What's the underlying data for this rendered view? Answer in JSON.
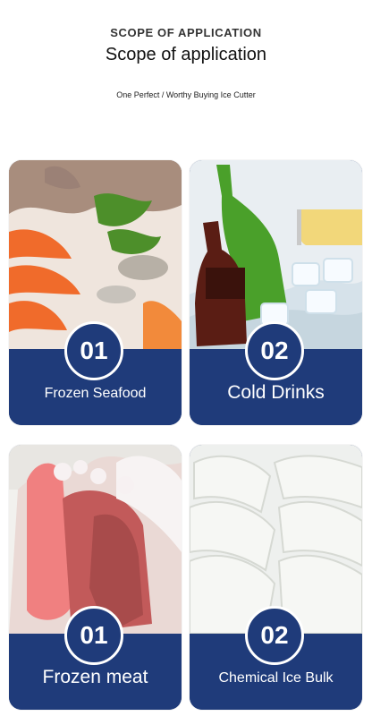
{
  "header": {
    "kicker": "SCOPE OF APPLICATION",
    "title": "Scope of application",
    "subtitle": "One Perfect / Worthy Buying Ice Cutter"
  },
  "cards": [
    {
      "number": "01",
      "label": "Frozen Seafood",
      "photo_icon": "seafood-photo"
    },
    {
      "number": "02",
      "label": "Cold Drinks",
      "photo_icon": "drinks-photo"
    },
    {
      "number": "01",
      "label": "Frozen meat",
      "photo_icon": "meat-photo"
    },
    {
      "number": "02",
      "label": "Chemical Ice Bulk",
      "photo_icon": "ice-bulk-photo"
    }
  ],
  "colors": {
    "band": "#1f3b7a",
    "badge_border": "#ffffff"
  }
}
